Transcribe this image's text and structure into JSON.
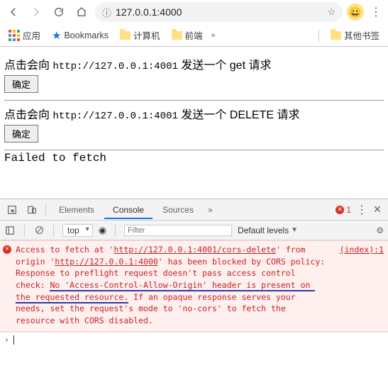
{
  "browser": {
    "url": "127.0.0.1:4000"
  },
  "bookmarks": {
    "apps": "应用",
    "bookmarks_label": "Bookmarks",
    "folder_computer": "计算机",
    "folder_frontend": "前端",
    "more": "»",
    "other": "其他书签"
  },
  "page": {
    "section1": {
      "prefix": "点击会向 ",
      "url": "http://127.0.0.1:4001",
      "suffix": " 发送一个 get 请求",
      "button": "确定"
    },
    "section2": {
      "prefix": "点击会向 ",
      "url": "http://127.0.0.1:4001",
      "suffix": " 发送一个 DELETE 请求",
      "button": "确定"
    },
    "fail": "Failed to fetch"
  },
  "devtools": {
    "tabs": {
      "elements": "Elements",
      "console": "Console",
      "sources": "Sources",
      "more": "»"
    },
    "error_count": "1",
    "filter": {
      "context": "top",
      "placeholder": "Filter",
      "levels": "Default levels"
    },
    "error": {
      "pre": "Access to fetch at '",
      "url1": "http://127.0.0.1:4001/cors-delete",
      "mid1": "' from origin '",
      "url2": "http://127.0.0.1:4000",
      "mid2": "' has been blocked by CORS policy: Response to preflight request doesn't pass access control check: ",
      "underlined": "No 'Access-Control-Allow-Origin' header is present on the requested resource.",
      "tail": " If an opaque response serves your needs, set the request's mode to 'no-cors' to fetch the resource with CORS disabled.",
      "source": "(index):1"
    }
  }
}
